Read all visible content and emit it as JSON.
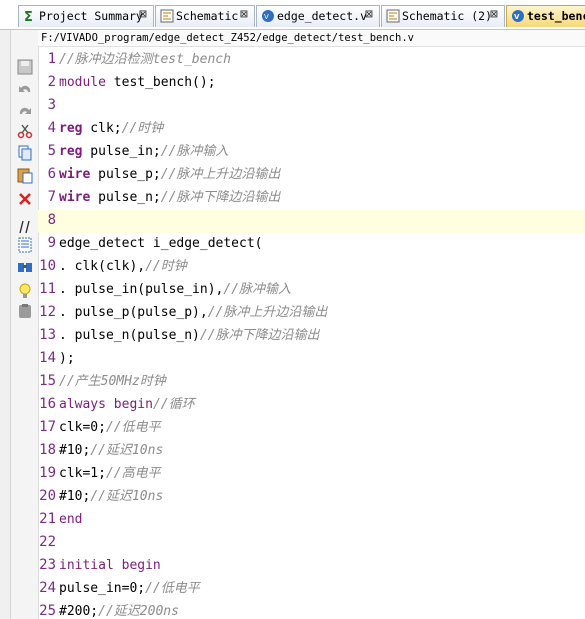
{
  "tabs": [
    {
      "label": "Project Summary",
      "icon": "sigma-icon",
      "active": false
    },
    {
      "label": "Schematic",
      "icon": "schematic-icon",
      "active": false
    },
    {
      "label": "edge_detect.v",
      "icon": "verilog-file-icon",
      "active": false
    },
    {
      "label": "Schematic (2)",
      "icon": "schematic-icon",
      "active": false
    },
    {
      "label": "test_bench",
      "icon": "verilog-file-icon",
      "active": true
    }
  ],
  "close_glyph": "⊠",
  "file_path": "F:/VIVADO_program/edge_detect_Z452/edge_detect/test_bench.v",
  "toolbar": [
    "save-icon",
    "undo-icon",
    "redo-icon",
    "cut-icon",
    "copy-icon",
    "paste-icon",
    "delete-icon",
    "comment-icon",
    "select-all-icon",
    "find-icon",
    "lightbulb-icon",
    "clipboard-icon"
  ],
  "lines": [
    {
      "n": "1",
      "t": "//脉冲边沿检测test_bench"
    },
    {
      "n": "2",
      "t": "module test_bench();"
    },
    {
      "n": "3",
      "t": ""
    },
    {
      "n": "4",
      "t": "reg clk;//时钟"
    },
    {
      "n": "5",
      "t": "reg pulse_in;//脉冲输入"
    },
    {
      "n": "6",
      "t": "wire pulse_p;//脉冲上升边沿输出"
    },
    {
      "n": "7",
      "t": "wire pulse_n;//脉冲下降边沿输出"
    },
    {
      "n": "8",
      "t": ""
    },
    {
      "n": "9",
      "t": "edge_detect i_edge_detect("
    },
    {
      "n": "10",
      "t": ". clk(clk),//时钟"
    },
    {
      "n": "11",
      "t": ". pulse_in(pulse_in),//脉冲输入"
    },
    {
      "n": "12",
      "t": ". pulse_p(pulse_p),//脉冲上升边沿输出"
    },
    {
      "n": "13",
      "t": ". pulse_n(pulse_n)//脉冲下降边沿输出"
    },
    {
      "n": "14",
      "t": ");"
    },
    {
      "n": "15",
      "t": "//产生50MHz时钟"
    },
    {
      "n": "16",
      "t": "always begin//循环"
    },
    {
      "n": "17",
      "t": "clk=0;//低电平"
    },
    {
      "n": "18",
      "t": "#10;//延迟10ns"
    },
    {
      "n": "19",
      "t": "clk=1;//高电平"
    },
    {
      "n": "20",
      "t": "#10;//延迟10ns"
    },
    {
      "n": "21",
      "t": "end"
    },
    {
      "n": "22",
      "t": ""
    },
    {
      "n": "23",
      "t": "initial begin"
    },
    {
      "n": "24",
      "t": "pulse_in=0;//低电平"
    },
    {
      "n": "25",
      "t": "#200;//延迟200ns"
    }
  ],
  "highlight_line": "8",
  "colors": {
    "keyword": "#7b1b7b",
    "comment": "#8c8c8c",
    "line_highlight": "#ffffe0"
  }
}
